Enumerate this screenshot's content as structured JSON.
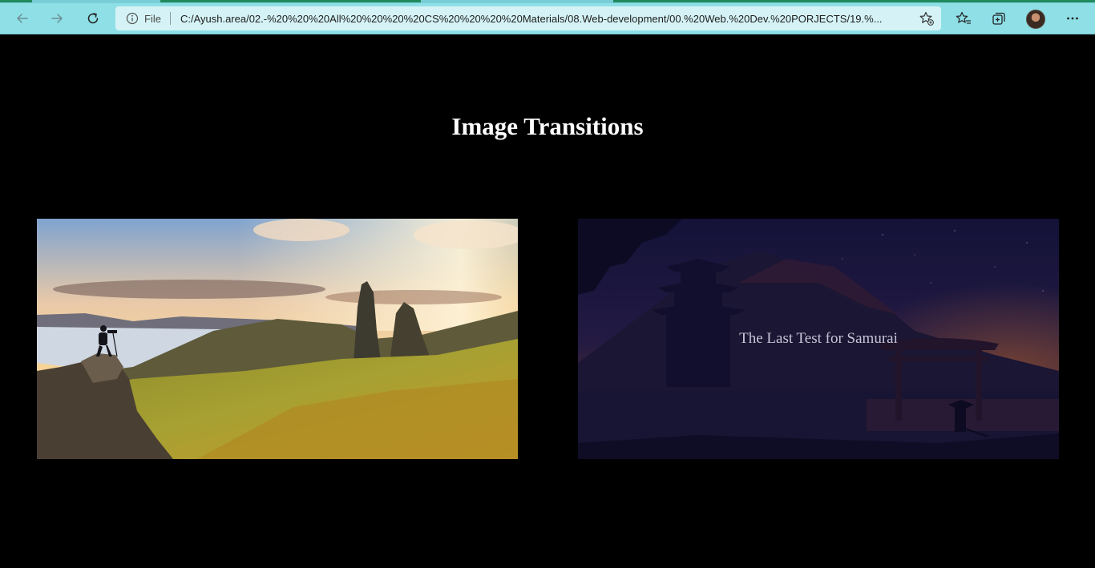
{
  "browser": {
    "address_bar": {
      "scheme_label": "File",
      "url": "C:/Ayush.area/02.-%20%20%20All%20%20%20%20CS%20%20%20%20Materials/08.Web-development/00.%20Web.%20Dev.%20PORJECTS/19.%..."
    },
    "icons": {
      "back": "back-arrow-icon",
      "forward": "forward-arrow-icon",
      "refresh": "refresh-icon",
      "info": "info-icon",
      "add_favorite": "star-add-icon",
      "favorites": "favorites-icon",
      "collections": "collections-icon",
      "profile": "profile-avatar",
      "menu": "more-menu-icon"
    },
    "colors": {
      "toolbar": "#8edfe6",
      "address_bar": "#d5f3f6"
    }
  },
  "page": {
    "heading": "Image Transitions",
    "background": "#000000",
    "cards": [
      {
        "image": "mountain-landscape-photographer",
        "caption": ""
      },
      {
        "image": "samurai-night-scene",
        "caption": "The Last Test for Samurai"
      }
    ]
  }
}
